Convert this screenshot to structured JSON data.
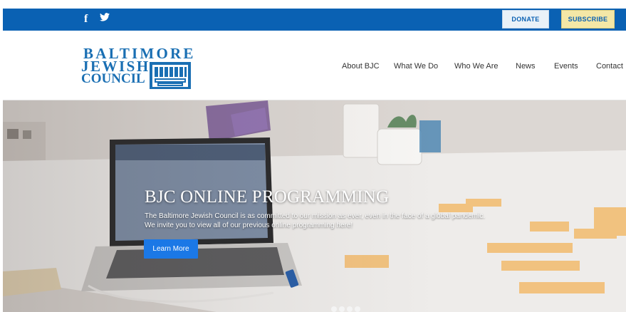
{
  "topbar": {
    "social": [
      {
        "name": "facebook-icon",
        "glyph": "f"
      },
      {
        "name": "twitter-icon",
        "glyph": "twitter"
      }
    ],
    "donate_label": "DONATE",
    "subscribe_label": "SUBSCRIBE",
    "bar_color": "#0a61b3"
  },
  "logo": {
    "line1": "BALTIMORE",
    "line2": "JEWISH",
    "line3": "COUNCIL",
    "color": "#1a6fb3"
  },
  "nav": {
    "items": [
      "About BJC",
      "What We Do",
      "Who We Are",
      "News",
      "Events",
      "Contact"
    ]
  },
  "hero": {
    "title": "BJC ONLINE PROGRAMMING",
    "text_line1": "The Baltimore Jewish Council is as committed to our mission as ever, even in the face of a global pandemic.",
    "text_line2": "We invite you to view all of our previous online programming here!",
    "button_label": "Learn More",
    "button_color": "#1b78e6",
    "slides_count": 4
  }
}
